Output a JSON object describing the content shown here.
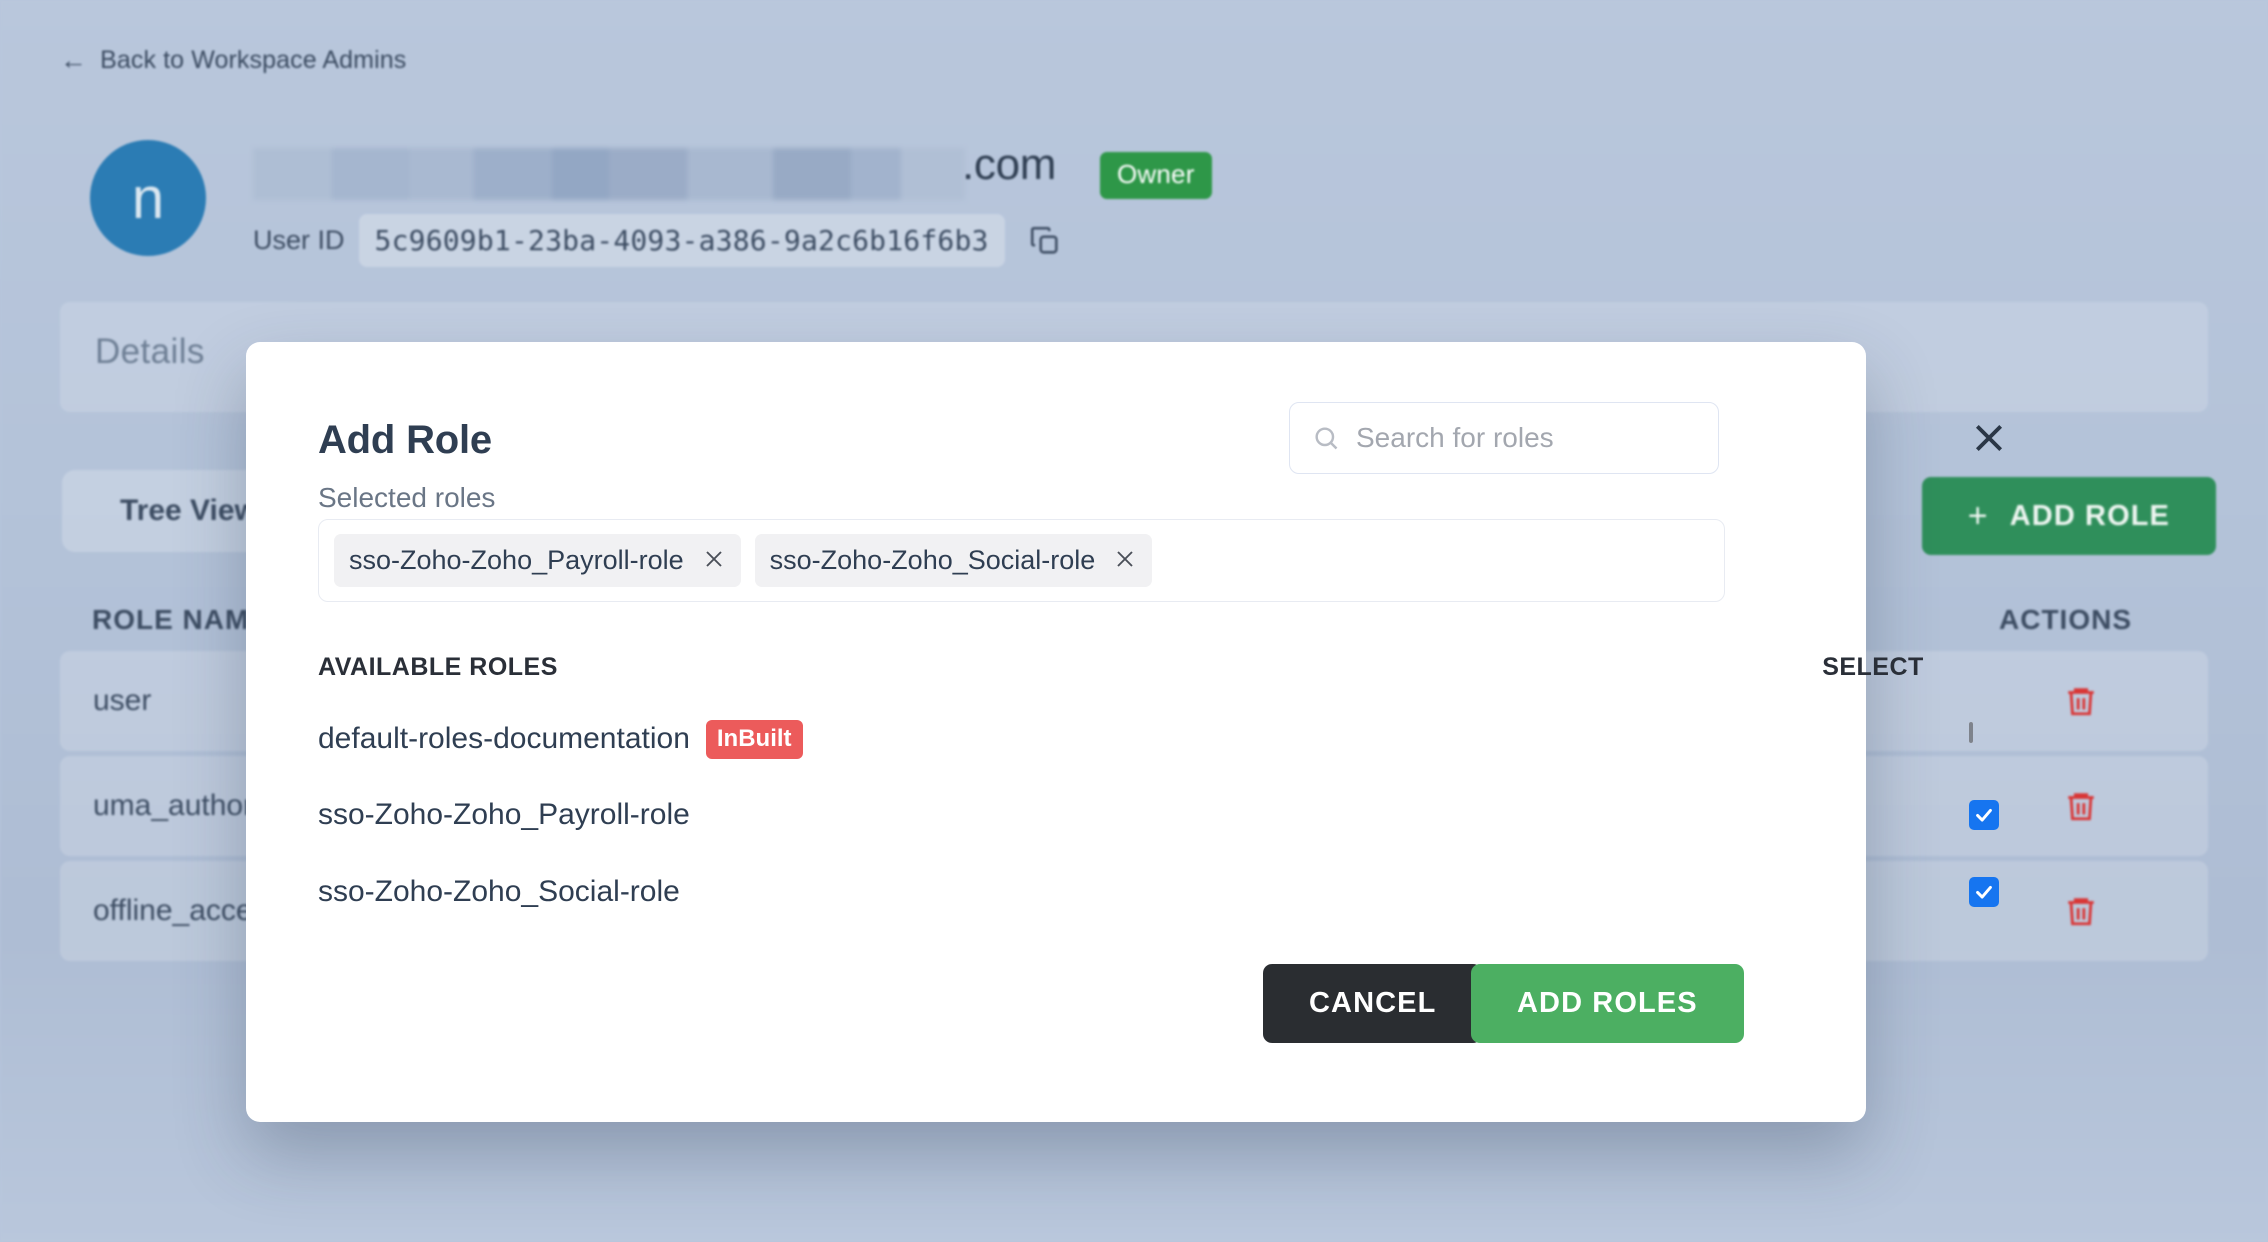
{
  "page": {
    "back_link": "Back to Workspace Admins",
    "back_arrow_icon": "arrow-left-icon",
    "avatar_initial": "n",
    "email_domain_suffix": ".com",
    "owner_badge": "Owner",
    "user_id_label": "User ID",
    "user_id_value": "5c9609b1-23ba-4093-a386-9a2c6b16f6b3",
    "copy_icon": "copy-icon",
    "details_tab": "Details",
    "tree_view_tab": "Tree View",
    "add_role_button": "ADD ROLE",
    "add_role_icon": "plus-icon",
    "columns": {
      "role_name": "ROLE NAME",
      "actions": "ACTIONS"
    },
    "rows": [
      {
        "role_name": "user",
        "action_icon": "trash-icon"
      },
      {
        "role_name": "uma_authorization",
        "action_icon": "trash-icon"
      },
      {
        "role_name": "offline_access",
        "action_icon": "trash-icon"
      }
    ],
    "colors": {
      "background": "#b7c6dc",
      "avatar": "#2b7cb4",
      "owner_badge": "#2e9748",
      "add_role": "#2f8f5b",
      "trash": "#d93636"
    }
  },
  "modal": {
    "title": "Add Role",
    "close_icon": "close-icon",
    "search": {
      "placeholder": "Search for roles",
      "value": "",
      "icon": "search-icon"
    },
    "selected_roles_label": "Selected roles",
    "selected_chips": [
      {
        "label": "sso-Zoho-Zoho_Payroll-role",
        "remove_icon": "close-icon"
      },
      {
        "label": "sso-Zoho-Zoho_Social-role",
        "remove_icon": "close-icon"
      }
    ],
    "list_headers": {
      "available": "AVAILABLE ROLES",
      "select": "SELECT"
    },
    "available_roles": [
      {
        "name": "default-roles-documentation",
        "badge": "InBuilt",
        "checked": false
      },
      {
        "name": "sso-Zoho-Zoho_Payroll-role",
        "badge": "",
        "checked": true
      },
      {
        "name": "sso-Zoho-Zoho_Social-role",
        "badge": "",
        "checked": true
      }
    ],
    "buttons": {
      "cancel": "CANCEL",
      "add": "ADD ROLES"
    },
    "colors": {
      "inbuilt_badge": "#ec5b5b",
      "checkbox_checked": "#1675f0",
      "cancel": "#2a2d31",
      "add": "#4caf62"
    }
  }
}
